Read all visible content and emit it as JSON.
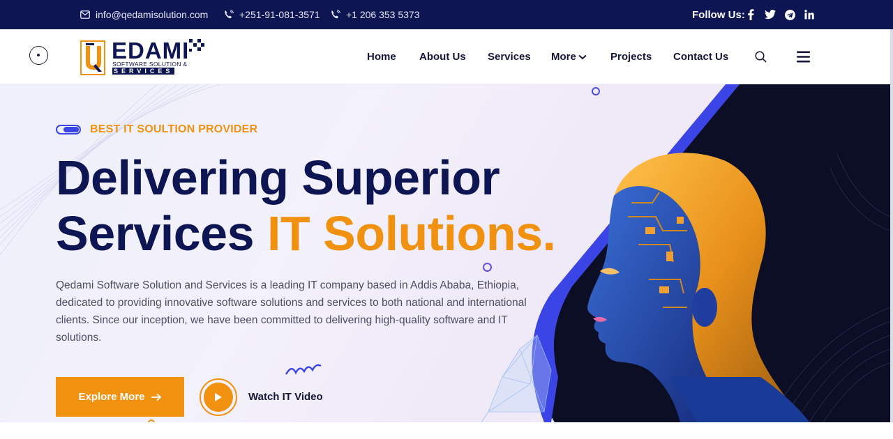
{
  "topbar": {
    "email": "info@qedamisolution.com",
    "phone1": "+251-91-081-3571",
    "phone2": "+1 206 353 5373",
    "follow_label": "Follow Us:",
    "socials": [
      "facebook-icon",
      "twitter-icon",
      "telegram-icon",
      "linkedin-icon"
    ]
  },
  "logo": {
    "name": "EDAMI",
    "tagline": "SOFTWARE SOLUTION &",
    "tagline2": "SERVICES"
  },
  "nav": {
    "items": [
      {
        "label": "Home"
      },
      {
        "label": "About Us"
      },
      {
        "label": "Services"
      },
      {
        "label": "More"
      },
      {
        "label": "Projects"
      },
      {
        "label": "Contact Us"
      }
    ]
  },
  "hero": {
    "badge": "BEST IT SOULTION PROVIDER",
    "headline_line1": "Delivering Superior",
    "headline_line2_dark": "Services ",
    "headline_line2_accent": "IT Solutions.",
    "description": "Qedami Software Solution and Services is a leading IT company based in Addis Ababa, Ethiopia, dedicated to providing innovative software solutions and services to both national and international clients. Since our inception, we have been committed to delivering high-quality software and IT solutions.",
    "explore_label": "Explore More",
    "watch_label": "Watch IT Video"
  },
  "colors": {
    "navy": "#0e1553",
    "accent_orange": "#f0920f",
    "accent_blue": "#3b44e4"
  }
}
